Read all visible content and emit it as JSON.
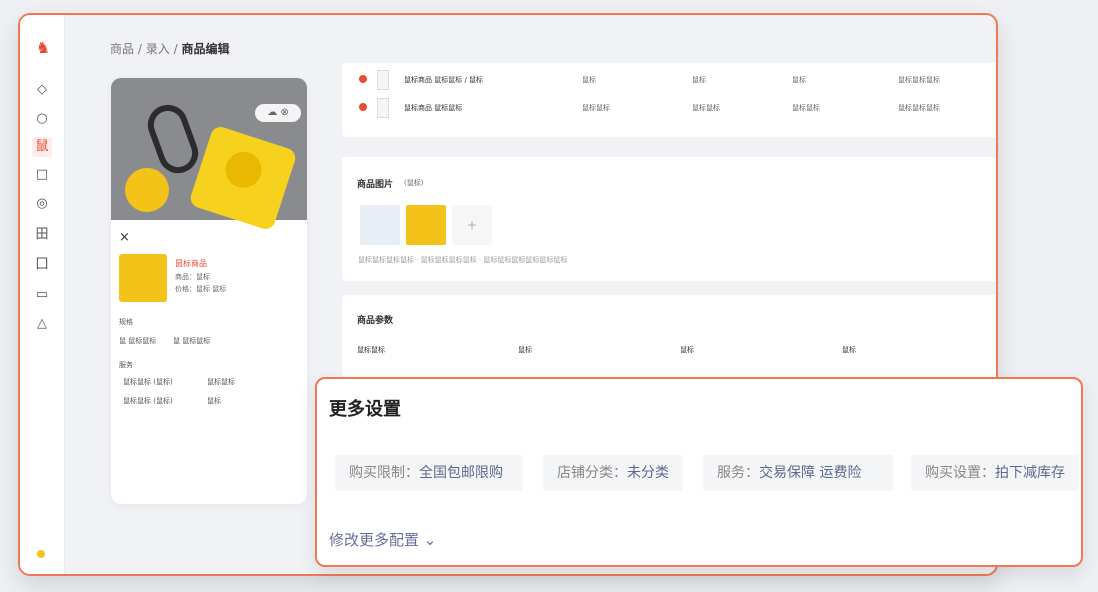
{
  "breadcrumb": {
    "items": [
      "商品",
      "录入"
    ],
    "current": "商品编辑",
    "sep": "/"
  },
  "sidebar": {
    "logo": "♞",
    "icons": [
      "◇",
      "○",
      "鼠",
      "□",
      "◎",
      "田",
      "囗",
      "▭",
      "△"
    ]
  },
  "preview": {
    "pill": "☁ ⊗",
    "close": "×",
    "product_title": "鼠标商品",
    "lines": [
      "商品：鼠标",
      "价格：鼠标 鼠标"
    ],
    "group1_label": "规格",
    "group1_items": [
      "鼠 鼠标鼠标",
      "鼠 鼠标鼠标"
    ],
    "group2_label": "服务",
    "group2_items": [
      "鼠标鼠标 (鼠标)",
      "鼠标鼠标",
      "鼠标鼠标 (鼠标)",
      "鼠标"
    ]
  },
  "sku_rows": [
    {
      "name": "鼠标商品 鼠标鼠标 / 鼠标",
      "c1": "鼠标",
      "c2": "鼠标",
      "c3": "鼠标",
      "c4": "鼠标鼠标鼠标"
    },
    {
      "name": "鼠标商品 鼠标鼠标",
      "c1": "鼠标鼠标",
      "c2": "鼠标鼠标",
      "c3": "鼠标鼠标",
      "c4": "鼠标鼠标鼠标"
    }
  ],
  "images_section": {
    "title": "商品图片",
    "hint": "(鼠标)",
    "caption": "鼠标鼠标鼠标鼠标 · 鼠标鼠标鼠标鼠标 · 鼠标鼠标鼠标鼠标鼠标鼠标",
    "add": "+"
  },
  "params_section": {
    "title": "商品参数",
    "headers": [
      "鼠标鼠标",
      "鼠标",
      "鼠标",
      "鼠标"
    ]
  },
  "more_settings": {
    "title": "更多设置",
    "items": [
      {
        "label": "购买限制：",
        "value": "全国包邮限购"
      },
      {
        "label": "店铺分类：",
        "value": "未分类"
      },
      {
        "label": "服务：",
        "value": "交易保障 运费险"
      },
      {
        "label": "购买设置：",
        "value": "拍下减库存"
      }
    ],
    "edit_link": "修改更多配置",
    "chevron": "⌄"
  },
  "colors": {
    "accent": "#e94a35",
    "border": "#ee7a55",
    "link": "#5b6a8c"
  }
}
